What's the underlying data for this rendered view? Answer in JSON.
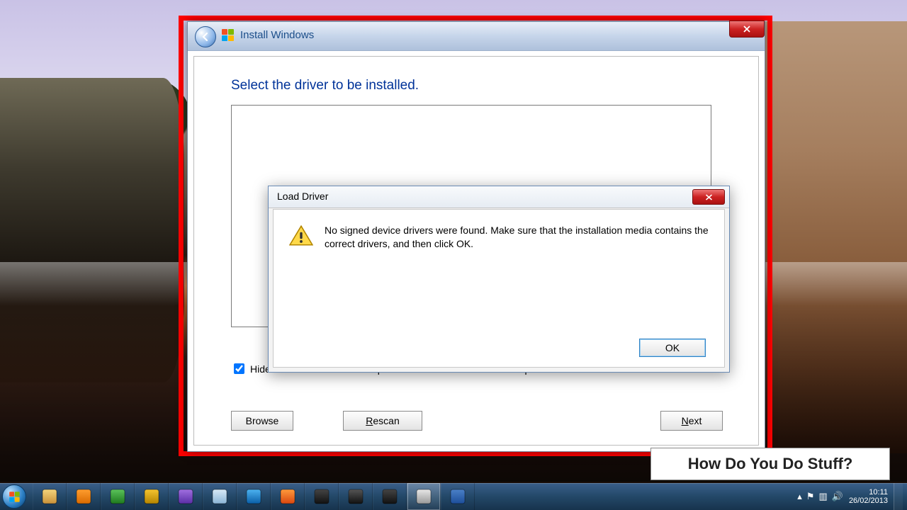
{
  "installer": {
    "window_title": "Install Windows",
    "heading": "Select the driver to be installed.",
    "hide_checkbox_label": "Hide drivers that are not compatible with hardware on this computer.",
    "hide_checkbox_checked": true,
    "buttons": {
      "browse": "Browse",
      "rescan": "Rescan",
      "next": "Next"
    }
  },
  "modal": {
    "title": "Load Driver",
    "message": "No signed device drivers were found. Make sure that the installation media contains the correct drivers, and then click OK.",
    "ok": "OK"
  },
  "watermark": "How Do You Do Stuff?",
  "taskbar": {
    "items": [
      {
        "name": "file-explorer",
        "color1": "#f4d47c",
        "color2": "#c9923a"
      },
      {
        "name": "media-player",
        "color1": "#ff9d2f",
        "color2": "#d96a00"
      },
      {
        "name": "task-manager",
        "color1": "#5bc25b",
        "color2": "#1e7a1e"
      },
      {
        "name": "vm-tool",
        "color1": "#f4c430",
        "color2": "#b58500"
      },
      {
        "name": "visual-studio",
        "color1": "#a06fe0",
        "color2": "#5a2ea6"
      },
      {
        "name": "notepad",
        "color1": "#d7e9f7",
        "color2": "#8ab4d6"
      },
      {
        "name": "internet-explorer",
        "color1": "#4cb2f0",
        "color2": "#0a5fa8"
      },
      {
        "name": "firefox",
        "color1": "#ff9a3c",
        "color2": "#d9480f"
      },
      {
        "name": "sublime",
        "color1": "#444",
        "color2": "#111"
      },
      {
        "name": "command-prompt",
        "color1": "#555",
        "color2": "#111"
      },
      {
        "name": "editor2",
        "color1": "#444",
        "color2": "#111"
      },
      {
        "name": "paint",
        "color1": "#e7e7e7",
        "color2": "#9a9a9a"
      },
      {
        "name": "word",
        "color1": "#4a80c7",
        "color2": "#1d4e9a"
      }
    ],
    "active_index": 11,
    "tray": {
      "time": "10:11",
      "date": "26/02/2013"
    }
  }
}
